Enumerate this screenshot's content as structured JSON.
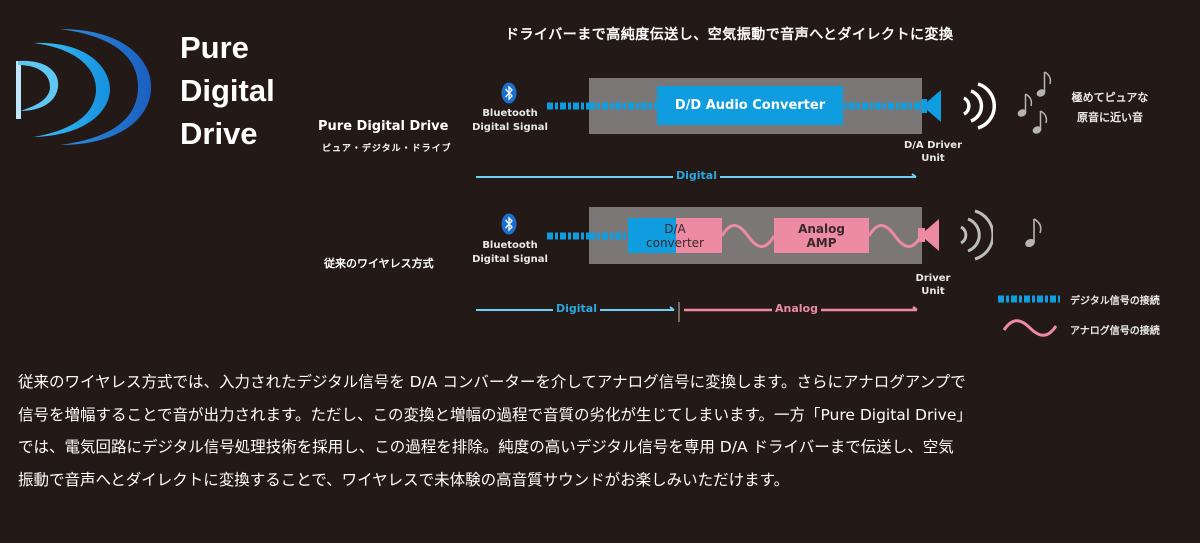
{
  "logo": {
    "lines": [
      "Pure",
      "Digital",
      "Drive"
    ],
    "colors": {
      "inner": "#9fd8f5",
      "mid": "#28a8e8",
      "outer": "#1a6fc8"
    }
  },
  "headline": "ドライバーまで高純度伝送し、空気振動で音声へとダイレクトに変換",
  "colors": {
    "background": "#231916",
    "digital_blue": "#0f9de0",
    "digital_line": "#6fd0f5",
    "analog_pink": "#ed8ba3",
    "process_gray": "#7a7776",
    "waves_white": "#ffffff",
    "waves_gray": "#bdbdbd"
  },
  "pdd_row": {
    "title": "Pure Digital Drive",
    "subtitle": "ピュア・デジタル・ドライブ",
    "source_icon": "bluetooth-icon",
    "source_label": [
      "Bluetooth",
      "Digital Signal"
    ],
    "converter_label": "D/D Audio Converter",
    "driver_label": [
      "D/A Driver",
      "Unit"
    ],
    "result_icon": "music-notes-icon",
    "result_text": [
      "極めてピュアな",
      "原音に近い音"
    ],
    "flow": [
      {
        "label": "Digital",
        "type": "digital"
      }
    ]
  },
  "conventional_row": {
    "title": "従来のワイヤレス方式",
    "source_icon": "bluetooth-icon",
    "source_label": [
      "Bluetooth",
      "Digital Signal"
    ],
    "da_converter_label": [
      "D/A",
      "converter"
    ],
    "amp_label": [
      "Analog",
      "AMP"
    ],
    "driver_label": [
      "Driver",
      "Unit"
    ],
    "result_icon": "music-note-icon",
    "flow": [
      {
        "label": "Digital",
        "type": "digital"
      },
      {
        "label": "Analog",
        "type": "analog"
      }
    ]
  },
  "legend": [
    {
      "type": "digital",
      "label": "デジタル信号の接続"
    },
    {
      "type": "analog",
      "label": "アナログ信号の接続"
    }
  ],
  "body_text": [
    "従来のワイヤレス方式では、入力されたデジタル信号を D/A コンバーターを介してアナログ信号に変換します。さらにアナログアンプで",
    "信号を増幅することで音が出力されます。ただし、この変換と増幅の過程で音質の劣化が生じてしまいます。一方「Pure Digital Drive」",
    "では、電気回路にデジタル信号処理技術を採用し、この過程を排除。純度の高いデジタル信号を専用 D/A ドライバーまで伝送し、空気",
    "振動で音声へとダイレクトに変換することで、ワイヤレスで未体験の高音質サウンドがお楽しみいただけます。"
  ]
}
